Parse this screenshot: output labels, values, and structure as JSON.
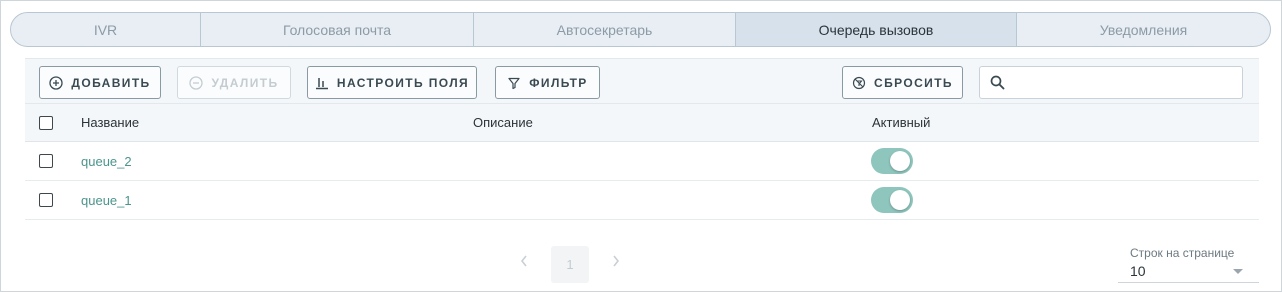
{
  "tabs": [
    {
      "label": "IVR",
      "active": false
    },
    {
      "label": "Голосовая почта",
      "active": false
    },
    {
      "label": "Автосекретарь",
      "active": false
    },
    {
      "label": "Очередь вызовов",
      "active": true
    },
    {
      "label": "Уведомления",
      "active": false
    }
  ],
  "toolbar": {
    "add_label": "ДОБАВИТЬ",
    "delete_label": "УДАЛИТЬ",
    "configure_fields_label": "НАСТРОИТЬ ПОЛЯ",
    "filter_label": "ФИЛЬТР",
    "reset_label": "СБРОСИТЬ",
    "search_value": "",
    "search_placeholder": ""
  },
  "table": {
    "columns": [
      "Название",
      "Описание",
      "Активный"
    ],
    "rows": [
      {
        "name": "queue_2",
        "description": "",
        "active": true
      },
      {
        "name": "queue_1",
        "description": "",
        "active": true
      }
    ]
  },
  "pagination": {
    "current_page": "1",
    "rows_per_page_label": "Строк на странице",
    "rows_per_page_value": "10"
  },
  "colors": {
    "accent": "#4b958c",
    "toggle_on": "#8ec5bd",
    "active_tab": "#d6e1ec"
  },
  "icons": {
    "add": "plus-circle-icon",
    "delete": "minus-circle-icon",
    "configure_fields": "columns-icon",
    "filter": "filter-icon",
    "reset": "reset-filter-icon",
    "search": "search-icon",
    "prev": "chevron-left-icon",
    "next": "chevron-right-icon"
  }
}
